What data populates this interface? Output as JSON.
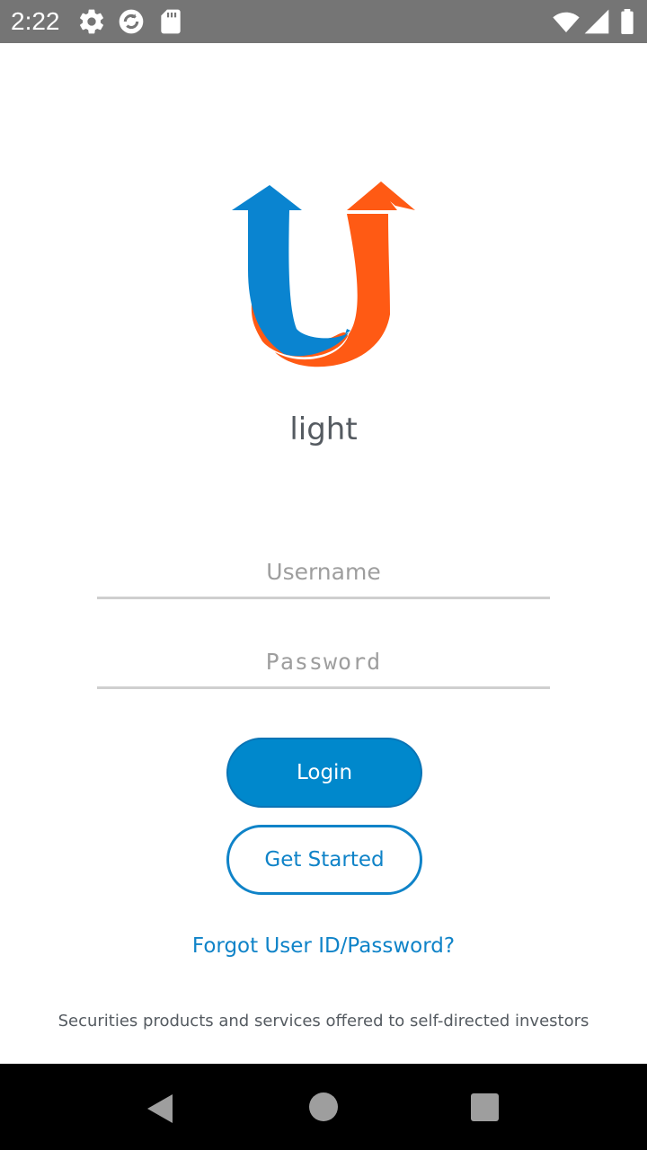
{
  "status_bar": {
    "time": "2:22",
    "icons": [
      "gear-icon",
      "sync-icon",
      "sd-card-icon",
      "wifi-icon",
      "signal-icon",
      "battery-icon"
    ]
  },
  "logo": {
    "left_arrow_color": "#0a84d0",
    "right_arrow_color": "#ff5a14"
  },
  "brand": {
    "name": "light"
  },
  "form": {
    "username_placeholder": "Username",
    "password_placeholder": "Password"
  },
  "buttons": {
    "login_label": "Login",
    "get_started_label": "Get Started"
  },
  "links": {
    "forgot_label": "Forgot User ID/Password?"
  },
  "footer": {
    "disclaimer": "Securities products and services offered to self-directed investors"
  },
  "nav_bar": {
    "icons": [
      "back-icon",
      "home-icon",
      "recents-icon"
    ]
  },
  "colors": {
    "accent": "#0088cc",
    "status_bar": "#757575",
    "nav_bar": "#000000"
  }
}
